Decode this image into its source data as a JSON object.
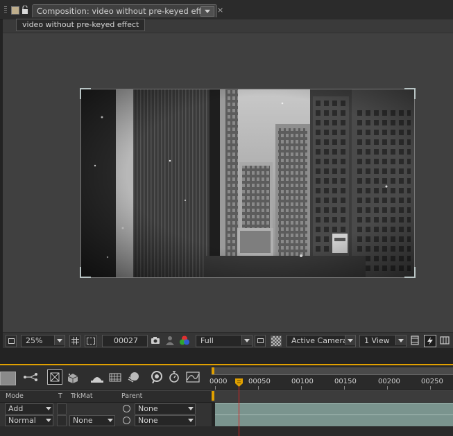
{
  "tab": {
    "title": "Composition: video without pre-keyed effect",
    "close_glyph": "×"
  },
  "breadcrumb": "video without pre-keyed effect",
  "viewer_toolbar": {
    "magnification": "25%",
    "timecode": "00027",
    "resolution": "Full",
    "camera": "Active Camera",
    "view_layout": "1 View"
  },
  "timeline": {
    "ruler_ticks": [
      "0000",
      "00050",
      "00100",
      "00150",
      "00200",
      "00250"
    ],
    "columns": {
      "mode": "Mode",
      "t": "T",
      "trkmat": "TrkMat",
      "parent": "Parent"
    },
    "layers": [
      {
        "mode": "Add",
        "trkmat": "",
        "parent": "None"
      },
      {
        "mode": "Normal",
        "trkmat": "None",
        "parent": "None"
      }
    ]
  },
  "colors": {
    "accent_orange": "#e0a000",
    "playhead_red": "#dd2222",
    "track_teal": "#7a948e"
  }
}
